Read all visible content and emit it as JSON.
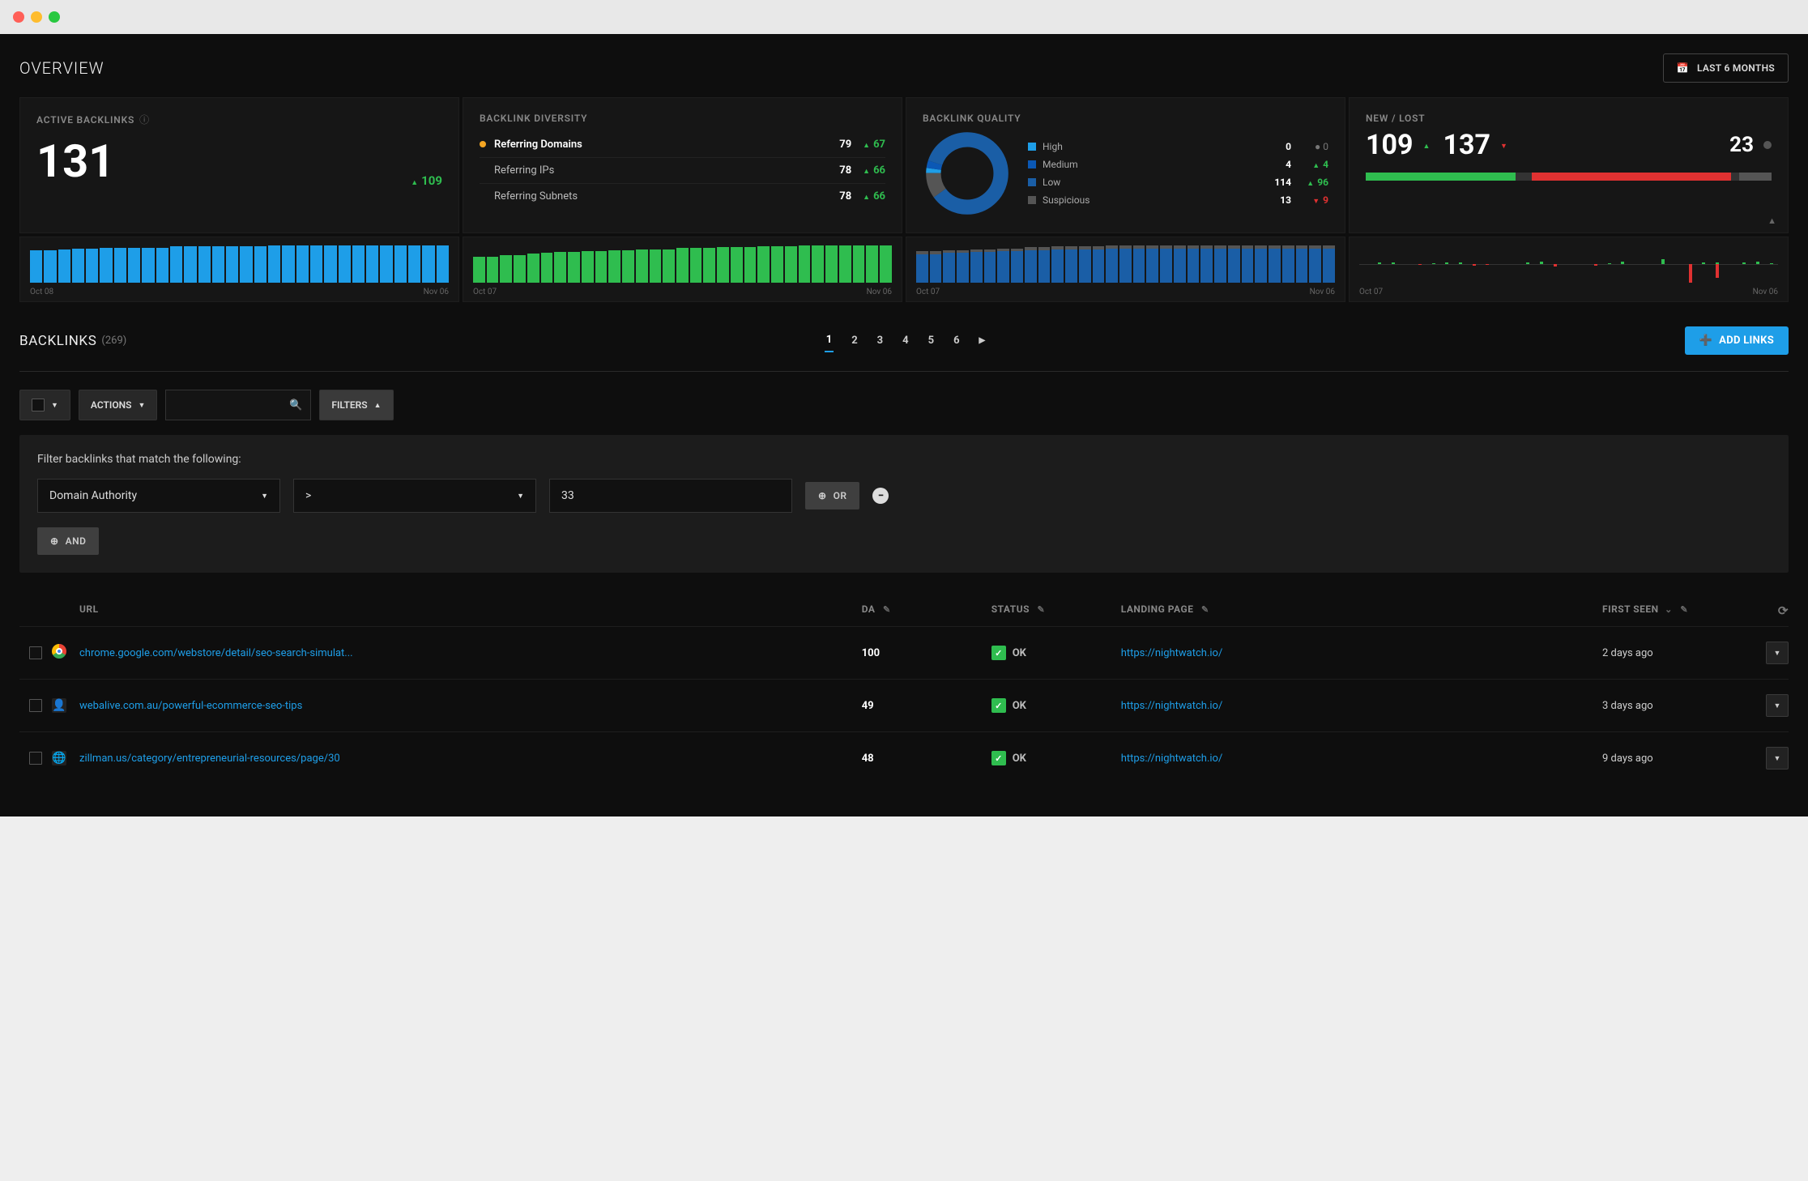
{
  "overview": {
    "title": "OVERVIEW",
    "range_label": "LAST 6 MONTHS"
  },
  "active_backlinks": {
    "title": "ACTIVE BACKLINKS",
    "value": "131",
    "delta": "109"
  },
  "diversity": {
    "title": "BACKLINK DIVERSITY",
    "rows": [
      {
        "label": "Referring Domains",
        "value": "79",
        "delta": "67",
        "active": true,
        "bullet": "#f5a623"
      },
      {
        "label": "Referring IPs",
        "value": "78",
        "delta": "66",
        "active": false,
        "bullet": ""
      },
      {
        "label": "Referring Subnets",
        "value": "78",
        "delta": "66",
        "active": false,
        "bullet": ""
      }
    ]
  },
  "quality": {
    "title": "BACKLINK QUALITY",
    "rows": [
      {
        "label": "High",
        "value": "0",
        "delta": "0",
        "delta_dir": "flat",
        "color": "#1e9ee8"
      },
      {
        "label": "Medium",
        "value": "4",
        "delta": "4",
        "delta_dir": "up",
        "color": "#0b58b5"
      },
      {
        "label": "Low",
        "value": "114",
        "delta": "96",
        "delta_dir": "up",
        "color": "#1a5ea6"
      },
      {
        "label": "Suspicious",
        "value": "13",
        "delta": "9",
        "delta_dir": "down",
        "color": "#555"
      }
    ],
    "donut": [
      {
        "color": "#1e9ee8",
        "pct": 2
      },
      {
        "color": "#0b58b5",
        "pct": 3
      },
      {
        "color": "#1a5ea6",
        "pct": 85
      },
      {
        "color": "#555",
        "pct": 10
      }
    ]
  },
  "newlost": {
    "title": "NEW / LOST",
    "new": "109",
    "lost": "137",
    "grey": "23",
    "bar": [
      {
        "color": "#2fbd4f",
        "pct": 37
      },
      {
        "color": "#333",
        "pct": 4
      },
      {
        "color": "#e03131",
        "pct": 49
      },
      {
        "color": "#333",
        "pct": 2
      },
      {
        "color": "#555",
        "pct": 8
      }
    ]
  },
  "chart_data": [
    {
      "type": "bar",
      "title": "Active Backlinks trend",
      "x_start": "Oct 08",
      "x_end": "Nov 06",
      "values": [
        32,
        32,
        33,
        34,
        34,
        35,
        35,
        35,
        35,
        35,
        36,
        36,
        36,
        36,
        36,
        36,
        36,
        37,
        37,
        37,
        37,
        37,
        37,
        37,
        37,
        37,
        37,
        37,
        37,
        37
      ],
      "color": "#1e9ee8"
    },
    {
      "type": "bar",
      "title": "Referring Domains trend",
      "x_start": "Oct 07",
      "x_end": "Nov 06",
      "values": [
        28,
        28,
        30,
        30,
        31,
        32,
        33,
        33,
        34,
        34,
        35,
        35,
        36,
        36,
        36,
        37,
        37,
        37,
        38,
        38,
        38,
        39,
        39,
        39,
        40,
        40,
        40,
        40,
        40,
        40,
        40
      ],
      "color": "#2fbd4f"
    },
    {
      "type": "bar",
      "title": "Backlink Quality (Low) trend",
      "x_start": "Oct 07",
      "x_end": "Nov 06",
      "series": [
        {
          "name": "low",
          "color": "#1a5ea6",
          "values": [
            30,
            30,
            31,
            31,
            32,
            32,
            33,
            33,
            34,
            34,
            35,
            35,
            35,
            35,
            36,
            36,
            36,
            36,
            36,
            36,
            36,
            36,
            36,
            36,
            36,
            36,
            36,
            36,
            36,
            36,
            36
          ]
        },
        {
          "name": "suspicious_cap",
          "color": "#555",
          "values": [
            3,
            3,
            3,
            3,
            3,
            3,
            3,
            3,
            3,
            3,
            3,
            3,
            3,
            3,
            3,
            3,
            3,
            3,
            3,
            3,
            3,
            3,
            3,
            3,
            3,
            3,
            3,
            3,
            3,
            3,
            3
          ]
        }
      ]
    },
    {
      "type": "bar",
      "title": "New / Lost per day",
      "x_start": "Oct 07",
      "x_end": "Nov 06",
      "series": [
        {
          "name": "new",
          "color": "#2fbd4f",
          "values": [
            0,
            2,
            2,
            0,
            0,
            1,
            2,
            2,
            0,
            0,
            0,
            0,
            2,
            3,
            0,
            0,
            0,
            0,
            1,
            3,
            0,
            0,
            6,
            0,
            0,
            2,
            2,
            0,
            2,
            3,
            1
          ]
        },
        {
          "name": "lost",
          "color": "#e03131",
          "values": [
            0,
            0,
            0,
            0,
            1,
            0,
            0,
            0,
            2,
            1,
            0,
            0,
            0,
            0,
            3,
            0,
            0,
            2,
            0,
            0,
            0,
            0,
            0,
            0,
            22,
            0,
            16,
            0,
            0,
            0,
            0
          ]
        }
      ]
    }
  ],
  "backlinks_section": {
    "title": "BACKLINKS",
    "count": "(269)",
    "pages": [
      "1",
      "2",
      "3",
      "4",
      "5",
      "6"
    ],
    "active_page": "1",
    "add_links_label": "ADD LINKS"
  },
  "toolbar": {
    "actions_label": "ACTIONS",
    "filters_label": "FILTERS"
  },
  "filters": {
    "intro": "Filter backlinks that match the following:",
    "field": "Domain Authority",
    "operator": ">",
    "value": "33",
    "or_label": "OR",
    "and_label": "AND"
  },
  "table": {
    "headers": {
      "url": "URL",
      "da": "DA",
      "status": "STATUS",
      "landing_page": "LANDING PAGE",
      "first_seen": "FIRST SEEN"
    },
    "rows": [
      {
        "favicon": "chrome",
        "url": "chrome.google.com/webstore/detail/seo-search-simulat...",
        "da": "100",
        "status": "OK",
        "landing_page": "https://nightwatch.io/",
        "first_seen": "2 days ago"
      },
      {
        "favicon": "person",
        "url": "webalive.com.au/powerful-ecommerce-seo-tips",
        "da": "49",
        "status": "OK",
        "landing_page": "https://nightwatch.io/",
        "first_seen": "3 days ago"
      },
      {
        "favicon": "globe",
        "url": "zillman.us/category/entrepreneurial-resources/page/30",
        "da": "48",
        "status": "OK",
        "landing_page": "https://nightwatch.io/",
        "first_seen": "9 days ago"
      }
    ]
  }
}
